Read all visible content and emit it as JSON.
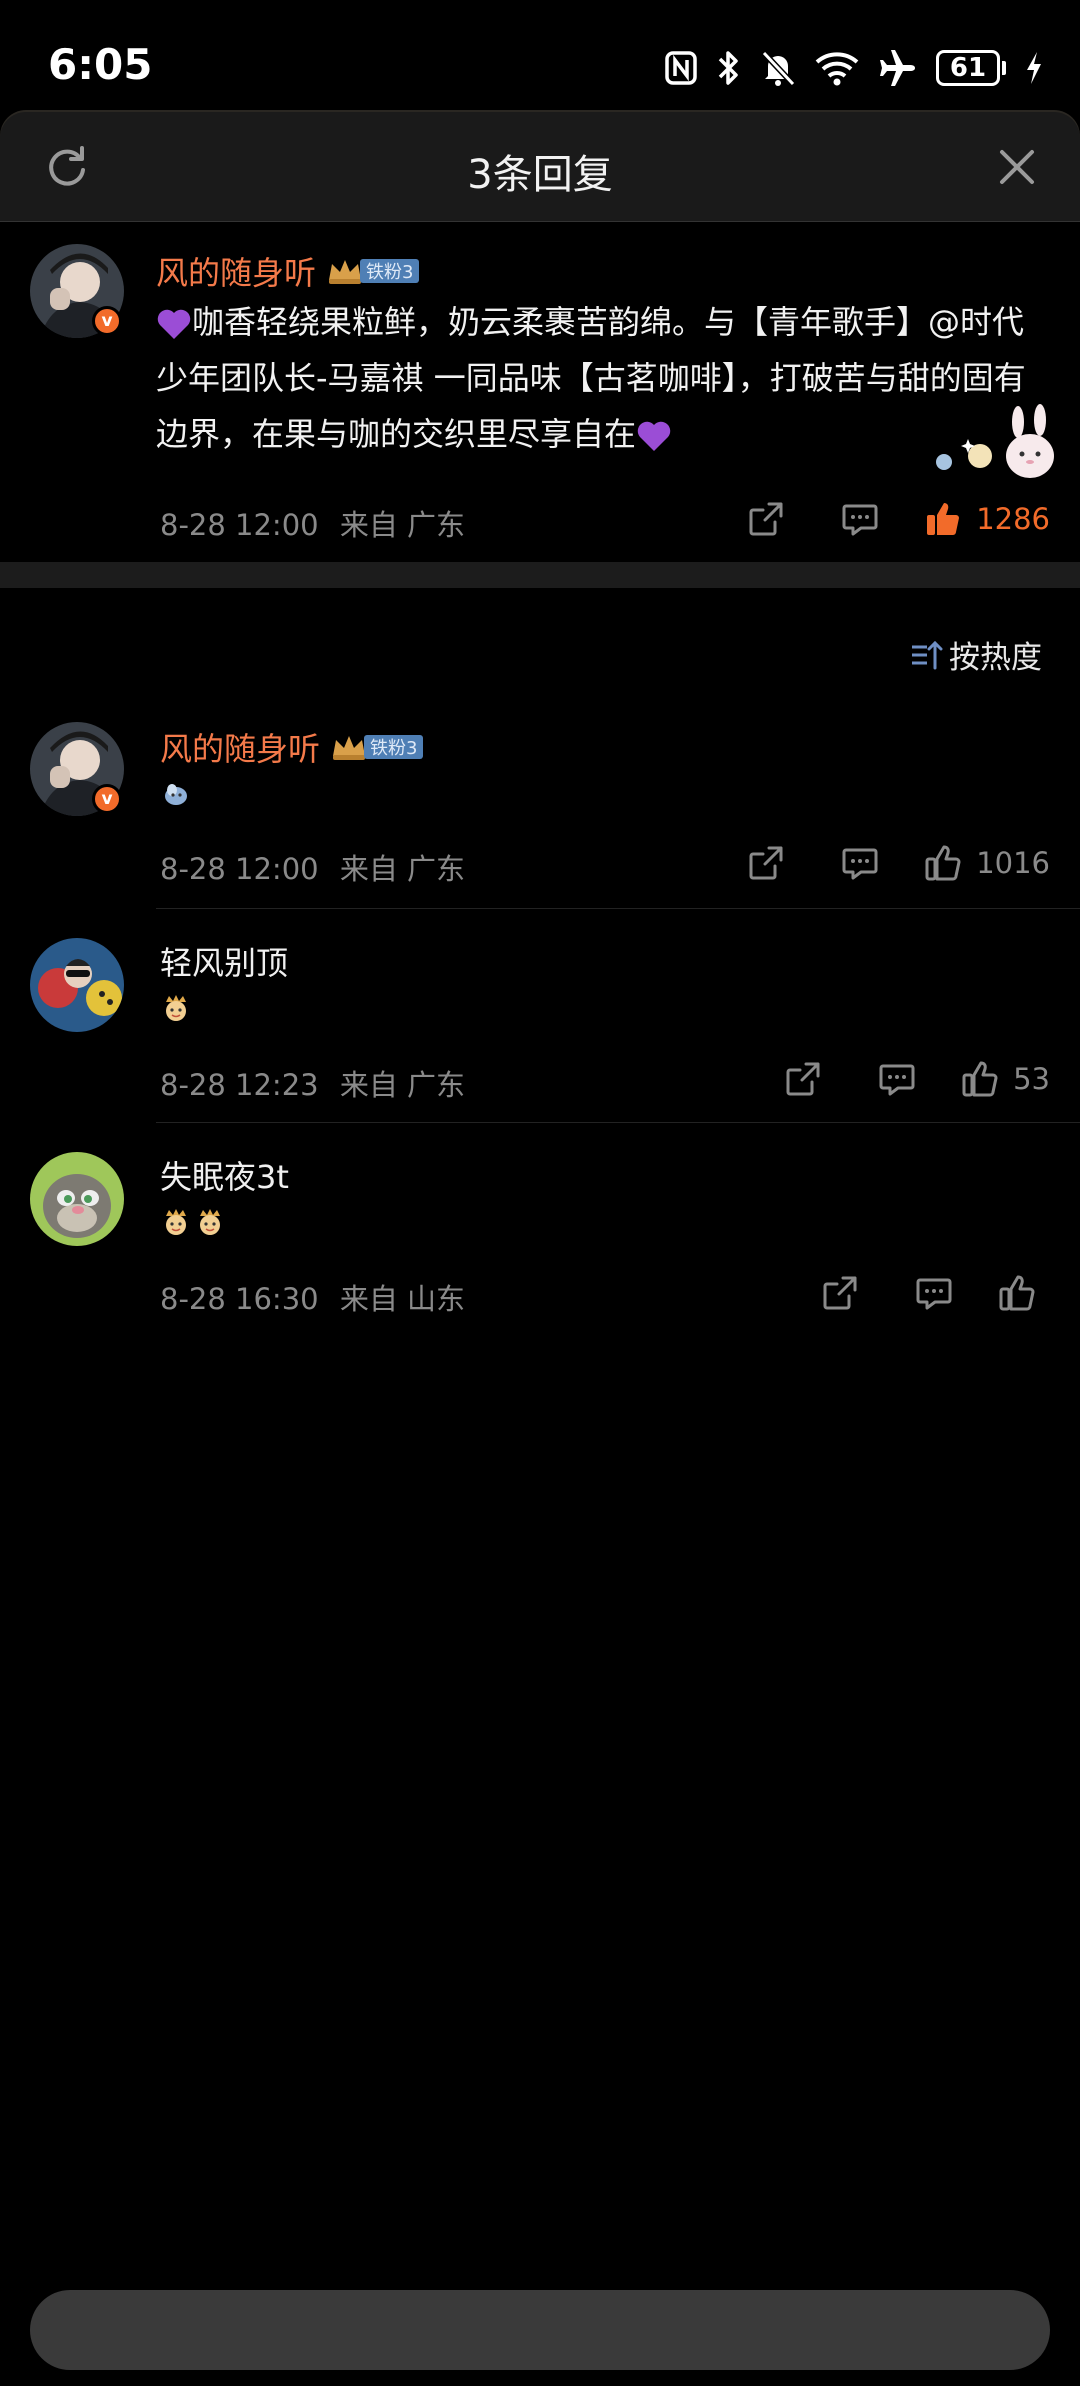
{
  "status": {
    "time": "6:05",
    "battery": "61"
  },
  "header": {
    "title": "3条回复"
  },
  "sort": {
    "label": "按热度"
  },
  "main_comment": {
    "username": "风的随身听",
    "fan_level": "铁粉3",
    "text": "咖香轻绕果粒鲜，奶云柔裹苦韵绵。与【青年歌手】@时代少年团队长-马嘉祺 一同品味【古茗咖啡】，打破苦与甜的固有边界，在果与咖的交织里尽享自在",
    "time": "8-28 12:00",
    "location": "来自 广东",
    "likes": "1286"
  },
  "replies": [
    {
      "username": "风的随身听",
      "fan_level": "铁粉3",
      "time": "8-28 12:00",
      "location": "来自 广东",
      "likes": "1016"
    },
    {
      "username": "轻风别顶",
      "time": "8-28 12:23",
      "location": "来自 广东",
      "likes": "53"
    },
    {
      "username": "失眠夜3t",
      "time": "8-28 16:30",
      "location": "来自 山东",
      "likes": ""
    }
  ],
  "input": {
    "placeholder": ""
  },
  "colors": {
    "accent": "#f26b2a",
    "username_orange": "#f47a4a",
    "fan_badge": "#4f7fb5",
    "heart": "#9b4dd6"
  }
}
